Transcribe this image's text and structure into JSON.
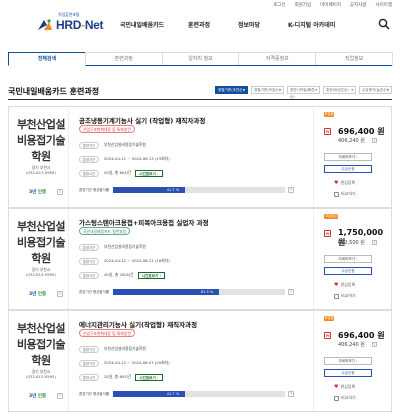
{
  "util": [
    "로그인",
    "회원가입",
    "마이페이지",
    "공지사항",
    "사이트맵"
  ],
  "header": {
    "slogan": "직업훈련포털",
    "logo_text": "HRD",
    "logo_dot": "-",
    "logo_suffix": "Net",
    "nav": [
      "국민내일배움카드",
      "훈련과정",
      "정보마당",
      "K-디지털 아카데미"
    ]
  },
  "tabs": [
    "전체검색",
    "훈련과정",
    "일자리 정보",
    "자격증정보",
    "직업정보"
  ],
  "section_title": "국민내일배움카드 훈련과정",
  "sort_buttons": [
    "정렬기준(추천순)",
    "정렬기준(모집순)",
    "훈련시작일(빠른순)",
    "훈련비(낮은순)",
    "수강평가(높은순)"
  ],
  "common": {
    "period_label": "훈련기간",
    "time_label": "훈련시간",
    "schedule_btn": "시간표보기",
    "schedule_arr": "›",
    "self_label": "실 부담액",
    "detail_btn": "자세히보기",
    "apply_btn": "수강신청",
    "interest": "관심등록",
    "compare": "비교하기",
    "cert_label": "인증",
    "q": "?",
    "price_tag": "₩"
  },
  "courses": [
    {
      "institution": "부천산업설비용접기술학원",
      "address": "경기 부천시",
      "phone": "(032-613-0995)",
      "cert_grade": "3년",
      "title": "공조냉동기계기능사 실기 (작업형) 재직자과정",
      "type": "산업구조변화대응 등 특화훈련",
      "type_color": "red",
      "place": "부천산업설비용접기술학원",
      "period": "2024-04-11 ~ 2024-06-13 (19회차)",
      "time": "20일, 총 60시간",
      "bar_label": "훈련기관 평균출석률",
      "bar_pct": 41.7,
      "bar_text": "41.7 %",
      "status": "모집중",
      "price": "696,400 원",
      "self_price": "406,240 원"
    },
    {
      "institution": "부천산업설비용접기술학원",
      "address": "경기 부천시",
      "phone": "(032-613-0995)",
      "cert_grade": "3년",
      "title": "가스텅스텐아크용접+피복아크용접 실업자 과정",
      "type": "국민내일배움카드 일반과정",
      "type_color": "green",
      "place": "부천산업설비용접기술학원",
      "period": "2024-04-12 ~ 2024-06-11 (16회차)",
      "time": "40일, 총 200시간",
      "bar_label": "훈련기관 평균출석률",
      "bar_pct": 61.5,
      "bar_text": "61.5 %",
      "status": "모집마감",
      "price": "1,750,000 원",
      "self_price": "662,500 원"
    },
    {
      "institution": "부천산업설비용접기술학원",
      "address": "경기 부천시",
      "phone": "(032-613-0995)",
      "cert_grade": "3년",
      "title": "에너지관리기능사 실기(작업형) 재직자과정",
      "type": "산업구조변화대응 등 특화훈련",
      "type_color": "red",
      "place": "부천산업설비용접기술학원",
      "period": "2024-04-12 ~ 2024-06-07 (20회차)",
      "time": "20일, 총 60시간",
      "bar_label": "훈련기관 평균출석률",
      "bar_pct": 41.7,
      "bar_text": "41.7 %",
      "status": "모집중",
      "price": "696,400 원",
      "self_price": "406,240 원"
    }
  ]
}
